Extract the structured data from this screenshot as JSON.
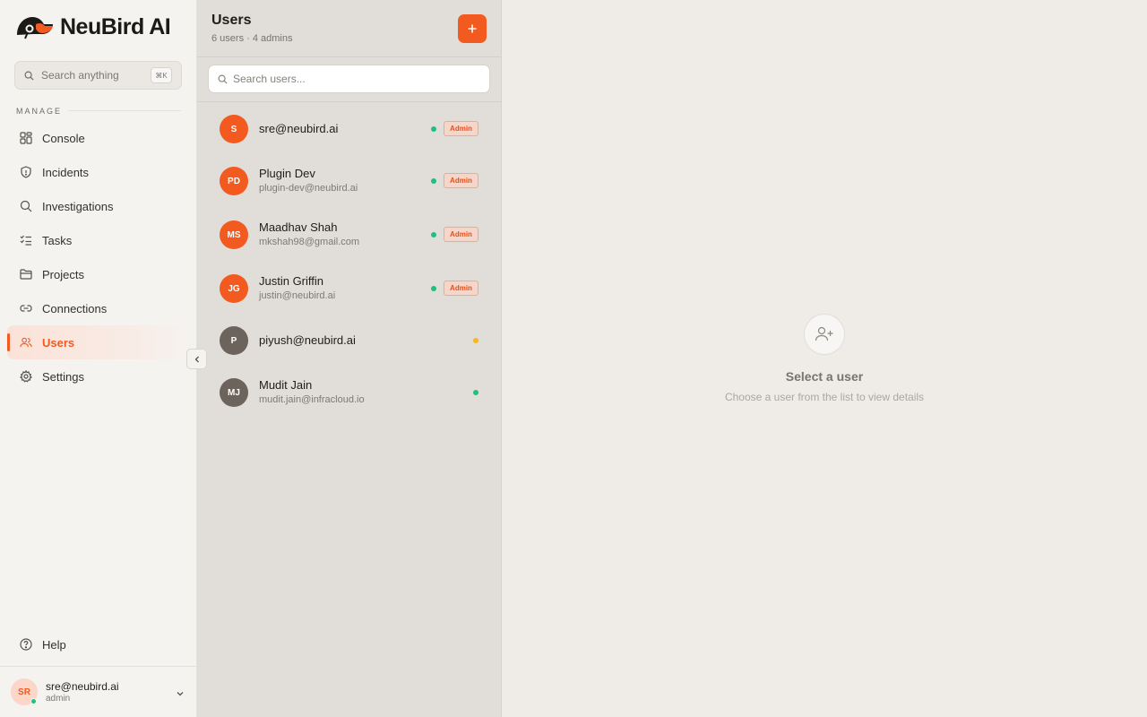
{
  "brand": {
    "name": "NeuBird AI",
    "accent": "#f35a20"
  },
  "sidebar": {
    "search_placeholder": "Search anything",
    "search_shortcut": "⌘K",
    "section_label": "MANAGE",
    "items": [
      {
        "label": "Console",
        "icon": "grid-icon",
        "active": false
      },
      {
        "label": "Incidents",
        "icon": "shield-icon",
        "active": false
      },
      {
        "label": "Investigations",
        "icon": "search-icon",
        "active": false
      },
      {
        "label": "Tasks",
        "icon": "checklist-icon",
        "active": false
      },
      {
        "label": "Projects",
        "icon": "folder-icon",
        "active": false
      },
      {
        "label": "Connections",
        "icon": "link-icon",
        "active": false
      },
      {
        "label": "Users",
        "icon": "users-icon",
        "active": true
      },
      {
        "label": "Settings",
        "icon": "gear-icon",
        "active": false
      }
    ],
    "help_label": "Help",
    "current_user": {
      "initials": "SR",
      "email": "sre@neubird.ai",
      "role": "admin"
    }
  },
  "users_panel": {
    "title": "Users",
    "subtitle": "6 users · 4 admins",
    "search_placeholder": "Search users...",
    "users": [
      {
        "initials": "S",
        "name": "sre@neubird.ai",
        "email": "",
        "status": "online",
        "admin_badge": "Admin",
        "avatar_color": "#f35a20"
      },
      {
        "initials": "PD",
        "name": "Plugin Dev",
        "email": "plugin-dev@neubird.ai",
        "status": "online",
        "admin_badge": "Admin",
        "avatar_color": "#f35a20"
      },
      {
        "initials": "MS",
        "name": "Maadhav Shah",
        "email": "mkshah98@gmail.com",
        "status": "online",
        "admin_badge": "Admin",
        "avatar_color": "#f35a20"
      },
      {
        "initials": "JG",
        "name": "Justin Griffin",
        "email": "justin@neubird.ai",
        "status": "online",
        "admin_badge": "Admin",
        "avatar_color": "#f35a20"
      },
      {
        "initials": "P",
        "name": "piyush@neubird.ai",
        "email": "",
        "status": "away",
        "admin_badge": "",
        "avatar_color": "#6b635c"
      },
      {
        "initials": "MJ",
        "name": "Mudit Jain",
        "email": "mudit.jain@infracloud.io",
        "status": "online",
        "admin_badge": "",
        "avatar_color": "#6b635c"
      }
    ],
    "status_colors": {
      "online": "#21c07a",
      "away": "#f5b820"
    }
  },
  "detail": {
    "empty_title": "Select a user",
    "empty_subtitle": "Choose a user from the list to view details"
  }
}
